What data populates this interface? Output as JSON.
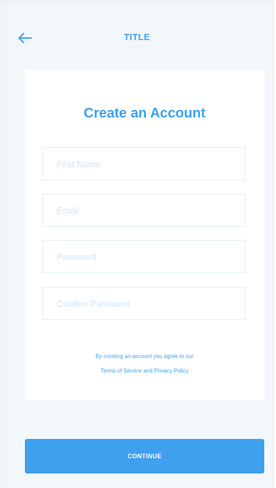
{
  "header": {
    "title": "TITLE",
    "back_icon": "arrow-left-icon"
  },
  "form": {
    "heading": "Create an Account",
    "fields": [
      {
        "placeholder": "First Name",
        "value": ""
      },
      {
        "placeholder": "Email",
        "value": ""
      },
      {
        "placeholder": "Password",
        "value": ""
      },
      {
        "placeholder": "Confirm Password",
        "value": ""
      }
    ],
    "legal_line1": "By creating an account you agree to our",
    "legal_line2": "Terms of Service and Privacy Policy"
  },
  "footer": {
    "continue_label": "CONTINUE"
  },
  "colors": {
    "accent": "#3fa0ee",
    "background": "#f2f7fc",
    "card": "#ffffff",
    "field_border": "#e3edf7",
    "placeholder": "#d4e4f3"
  }
}
